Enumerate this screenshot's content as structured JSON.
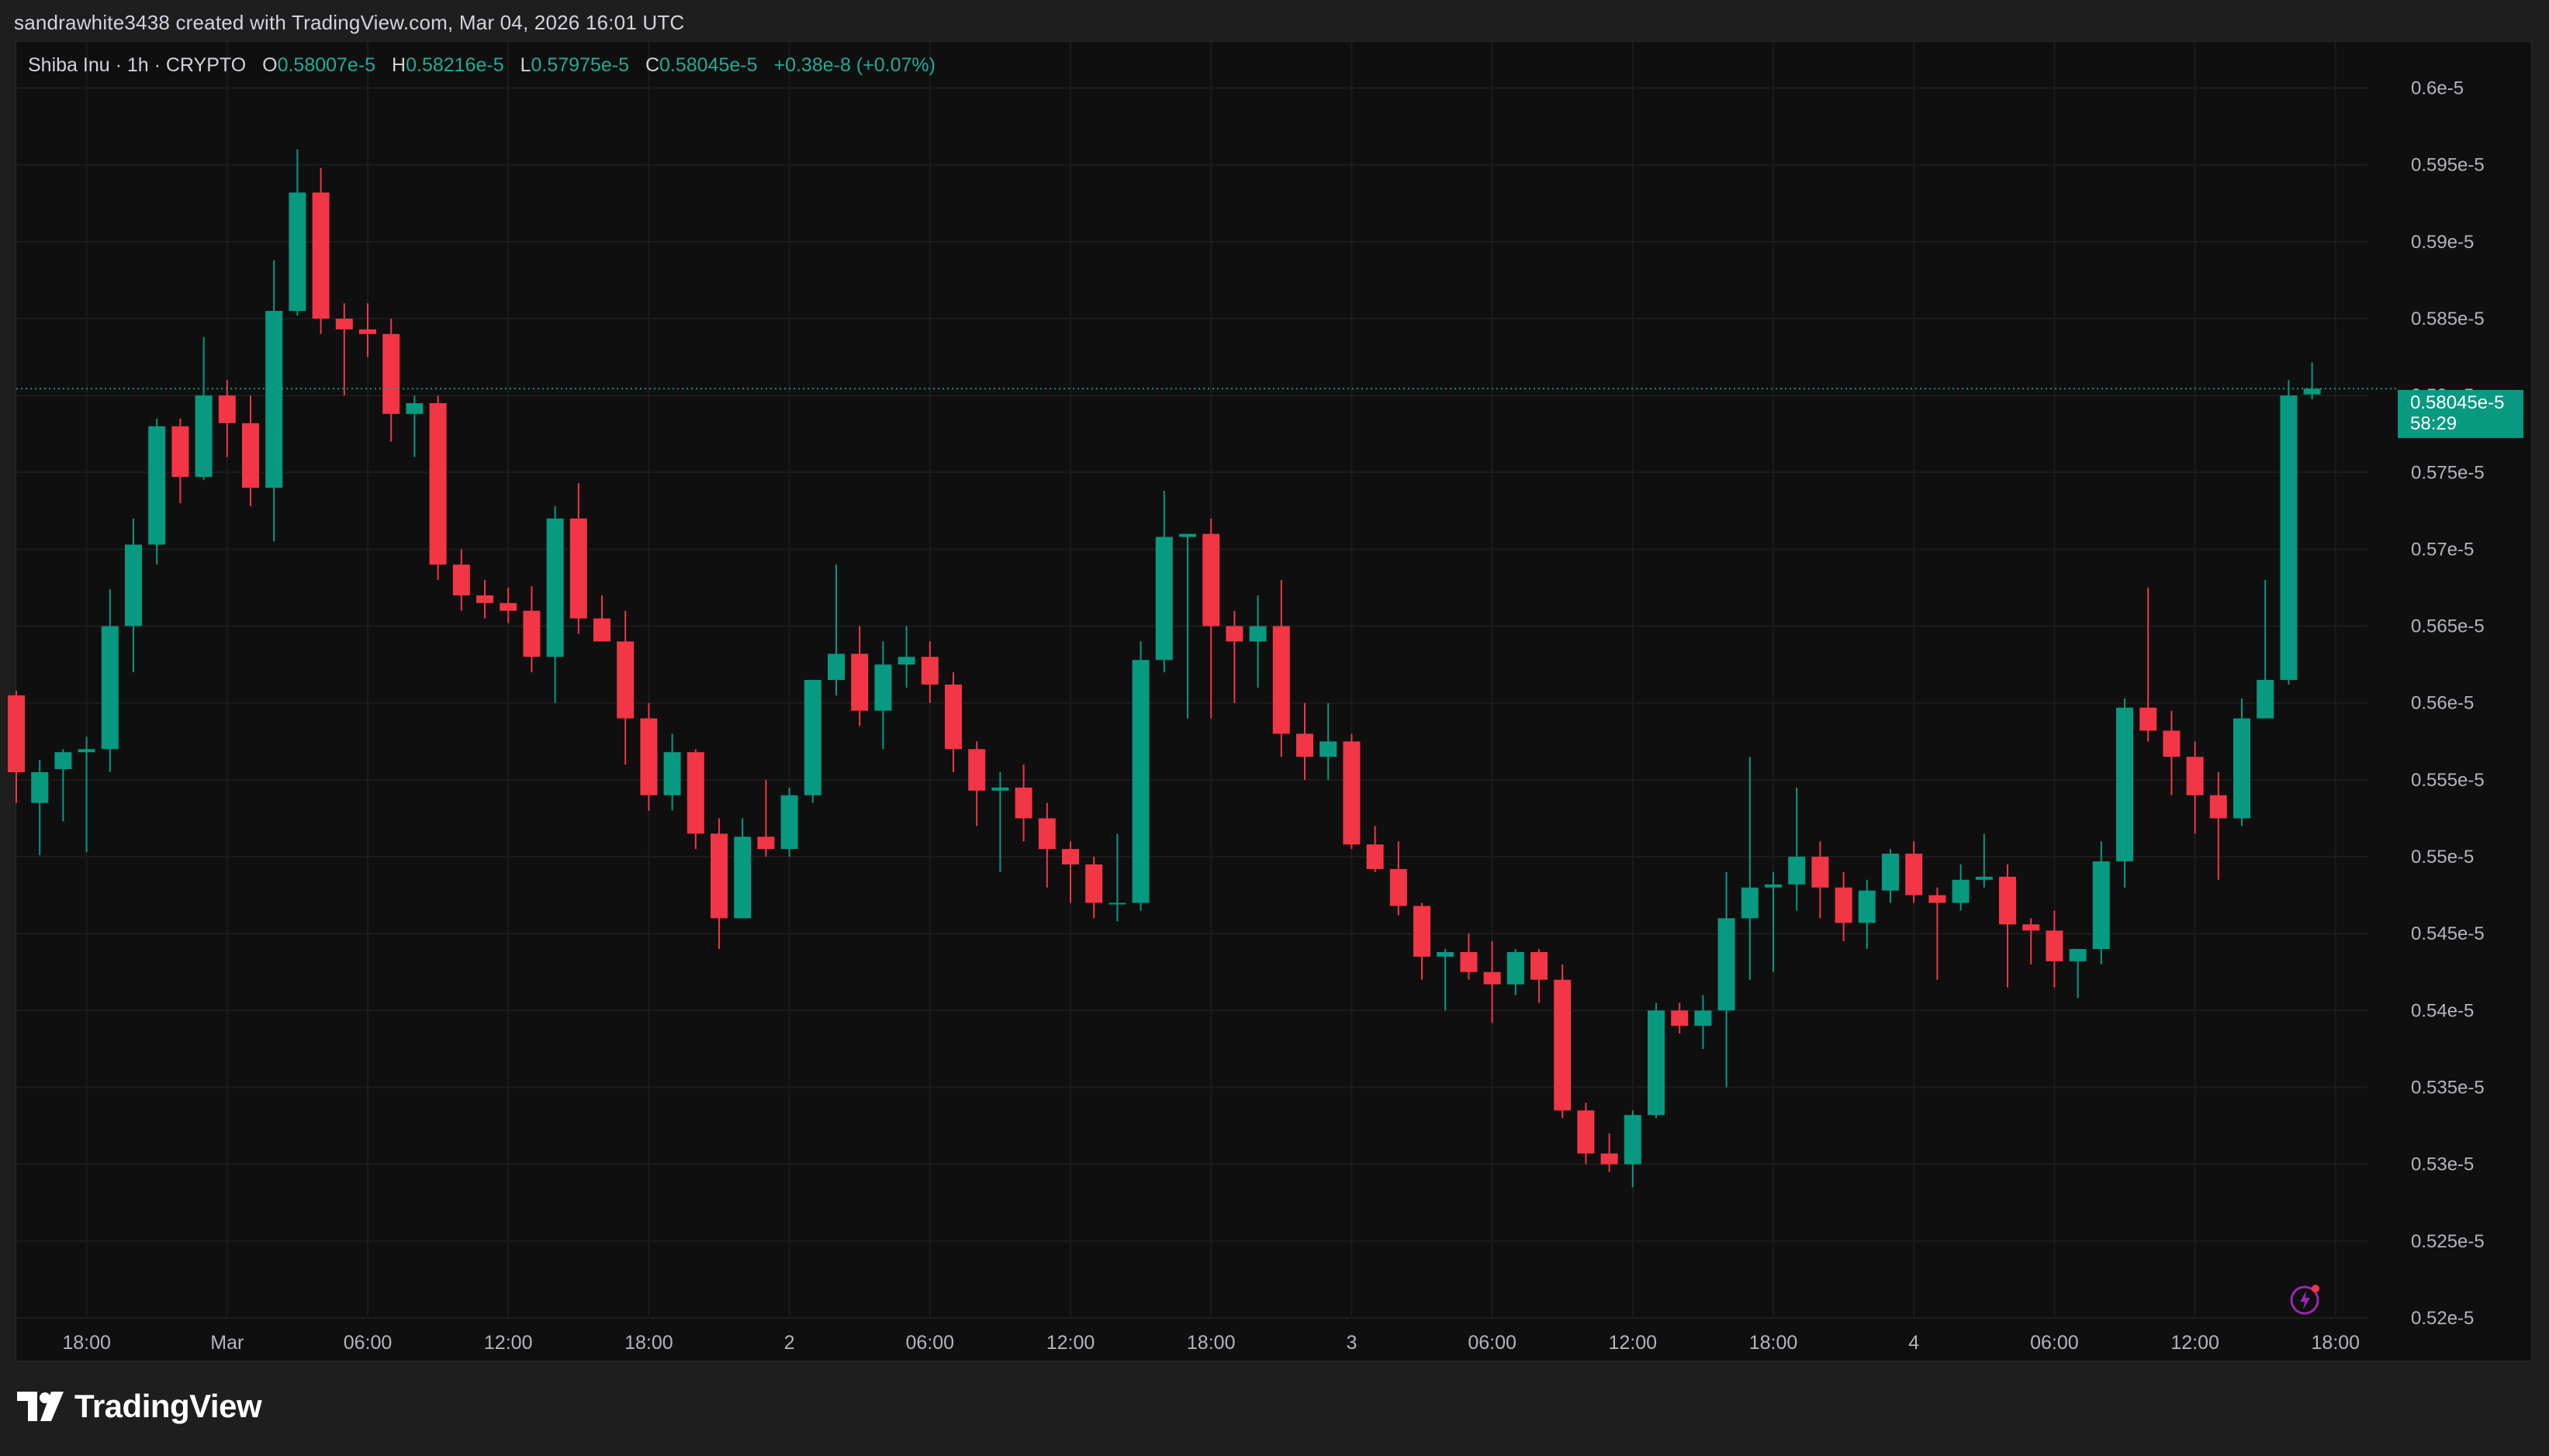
{
  "caption": "sandrawhite3438 created with TradingView.com, Mar 04, 2026 16:01 UTC",
  "legend": {
    "symbol": "Shiba Inu · 1h · CRYPTO",
    "o_label": "O",
    "o_value": "0.58007e-5",
    "h_label": "H",
    "h_value": "0.58216e-5",
    "l_label": "L",
    "l_value": "0.57975e-5",
    "c_label": "C",
    "c_value": "0.58045e-5",
    "change": "+0.38e-8 (+0.07%)"
  },
  "last_price": {
    "value": "0.58045e-5",
    "countdown": "58:29"
  },
  "brand": "TradingView",
  "icons": [
    "tradingview-logo-icon",
    "lightning-icon"
  ],
  "colors": {
    "up": "#089981",
    "down": "#f23645",
    "background": "#0f0f0f",
    "grid": "#1c1c1c",
    "text": "#d1d4dc"
  },
  "chart_data": {
    "type": "candlestick",
    "interval": "1h",
    "y_unit": "e-5",
    "ylim": [
      0.52,
      0.603
    ],
    "y_ticks": [
      0.6,
      0.595,
      0.59,
      0.585,
      0.58,
      0.575,
      0.57,
      0.565,
      0.56,
      0.555,
      0.55,
      0.545,
      0.54,
      0.535,
      0.53,
      0.525,
      0.52
    ],
    "y_tick_labels": [
      "0.6e-5",
      "0.595e-5",
      "0.59e-5",
      "0.585e-5",
      "0.58e-5",
      "0.575e-5",
      "0.57e-5",
      "0.565e-5",
      "0.56e-5",
      "0.555e-5",
      "0.55e-5",
      "0.545e-5",
      "0.54e-5",
      "0.535e-5",
      "0.53e-5",
      "0.525e-5",
      "0.52e-5"
    ],
    "x_ticks": [
      {
        "index": 3,
        "label": "18:00"
      },
      {
        "index": 9,
        "label": "Mar"
      },
      {
        "index": 15,
        "label": "06:00"
      },
      {
        "index": 21,
        "label": "12:00"
      },
      {
        "index": 27,
        "label": "18:00"
      },
      {
        "index": 33,
        "label": "2"
      },
      {
        "index": 39,
        "label": "06:00"
      },
      {
        "index": 45,
        "label": "12:00"
      },
      {
        "index": 51,
        "label": "18:00"
      },
      {
        "index": 57,
        "label": "3"
      },
      {
        "index": 63,
        "label": "06:00"
      },
      {
        "index": 69,
        "label": "12:00"
      },
      {
        "index": 75,
        "label": "18:00"
      },
      {
        "index": 81,
        "label": "4"
      },
      {
        "index": 87,
        "label": "06:00"
      },
      {
        "index": 93,
        "label": "12:00"
      },
      {
        "index": 99,
        "label": "18:00"
      }
    ],
    "x_slots": 101,
    "candles": [
      [
        0.5605,
        0.5608,
        0.5535,
        0.5555
      ],
      [
        0.5535,
        0.5563,
        0.5501,
        0.5555
      ],
      [
        0.5557,
        0.557,
        0.5523,
        0.5568
      ],
      [
        0.5568,
        0.5578,
        0.5503,
        0.557
      ],
      [
        0.557,
        0.5674,
        0.5555,
        0.565
      ],
      [
        0.565,
        0.572,
        0.562,
        0.5703
      ],
      [
        0.5703,
        0.5785,
        0.569,
        0.578
      ],
      [
        0.578,
        0.5785,
        0.573,
        0.5747
      ],
      [
        0.5747,
        0.5838,
        0.5745,
        0.58
      ],
      [
        0.58,
        0.581,
        0.576,
        0.5782
      ],
      [
        0.5782,
        0.58,
        0.5728,
        0.574
      ],
      [
        0.574,
        0.5888,
        0.5705,
        0.5855
      ],
      [
        0.5855,
        0.596,
        0.5852,
        0.5932
      ],
      [
        0.5932,
        0.5948,
        0.584,
        0.585
      ],
      [
        0.585,
        0.586,
        0.58,
        0.5843
      ],
      [
        0.5843,
        0.586,
        0.5825,
        0.584
      ],
      [
        0.584,
        0.585,
        0.577,
        0.5788
      ],
      [
        0.5788,
        0.58,
        0.576,
        0.5795
      ],
      [
        0.5795,
        0.58,
        0.568,
        0.569
      ],
      [
        0.569,
        0.57,
        0.566,
        0.567
      ],
      [
        0.567,
        0.568,
        0.5655,
        0.5665
      ],
      [
        0.5665,
        0.5675,
        0.5652,
        0.566
      ],
      [
        0.566,
        0.5676,
        0.562,
        0.563
      ],
      [
        0.563,
        0.5728,
        0.56,
        0.572
      ],
      [
        0.572,
        0.5743,
        0.5645,
        0.5655
      ],
      [
        0.5655,
        0.567,
        0.564,
        0.564
      ],
      [
        0.564,
        0.566,
        0.556,
        0.559
      ],
      [
        0.559,
        0.56,
        0.553,
        0.554
      ],
      [
        0.554,
        0.558,
        0.553,
        0.5568
      ],
      [
        0.5568,
        0.557,
        0.5505,
        0.5515
      ],
      [
        0.5515,
        0.5525,
        0.544,
        0.546
      ],
      [
        0.546,
        0.5525,
        0.546,
        0.5513
      ],
      [
        0.5513,
        0.555,
        0.55,
        0.5505
      ],
      [
        0.5505,
        0.5545,
        0.55,
        0.554
      ],
      [
        0.554,
        0.558,
        0.5535,
        0.5615
      ],
      [
        0.5615,
        0.569,
        0.5605,
        0.5632
      ],
      [
        0.5632,
        0.565,
        0.5585,
        0.5595
      ],
      [
        0.5595,
        0.564,
        0.557,
        0.5625
      ],
      [
        0.5625,
        0.565,
        0.561,
        0.563
      ],
      [
        0.563,
        0.564,
        0.56,
        0.5612
      ],
      [
        0.5612,
        0.562,
        0.5555,
        0.557
      ],
      [
        0.557,
        0.5575,
        0.552,
        0.5543
      ],
      [
        0.5543,
        0.5555,
        0.549,
        0.5545
      ],
      [
        0.5545,
        0.556,
        0.551,
        0.5525
      ],
      [
        0.5525,
        0.5535,
        0.548,
        0.5505
      ],
      [
        0.5505,
        0.551,
        0.547,
        0.5495
      ],
      [
        0.5495,
        0.55,
        0.546,
        0.547
      ],
      [
        0.547,
        0.5515,
        0.5458,
        0.547
      ],
      [
        0.547,
        0.564,
        0.5465,
        0.5628
      ],
      [
        0.5628,
        0.5738,
        0.562,
        0.5708
      ],
      [
        0.5708,
        0.571,
        0.559,
        0.571
      ],
      [
        0.571,
        0.572,
        0.559,
        0.565
      ],
      [
        0.565,
        0.566,
        0.56,
        0.564
      ],
      [
        0.564,
        0.567,
        0.561,
        0.565
      ],
      [
        0.565,
        0.568,
        0.5565,
        0.558
      ],
      [
        0.558,
        0.56,
        0.555,
        0.5565
      ],
      [
        0.5565,
        0.56,
        0.555,
        0.5575
      ],
      [
        0.5575,
        0.558,
        0.5505,
        0.5508
      ],
      [
        0.5508,
        0.552,
        0.549,
        0.5492
      ],
      [
        0.5492,
        0.551,
        0.5462,
        0.5468
      ],
      [
        0.5468,
        0.547,
        0.542,
        0.5435
      ],
      [
        0.5435,
        0.544,
        0.54,
        0.5438
      ],
      [
        0.5438,
        0.545,
        0.542,
        0.5425
      ],
      [
        0.5425,
        0.5445,
        0.5392,
        0.5417
      ],
      [
        0.5417,
        0.544,
        0.541,
        0.5438
      ],
      [
        0.5438,
        0.544,
        0.5405,
        0.542
      ],
      [
        0.542,
        0.543,
        0.533,
        0.5335
      ],
      [
        0.5335,
        0.534,
        0.53,
        0.5307
      ],
      [
        0.5307,
        0.532,
        0.5295,
        0.53
      ],
      [
        0.53,
        0.5335,
        0.5285,
        0.5332
      ],
      [
        0.5332,
        0.5405,
        0.533,
        0.54
      ],
      [
        0.54,
        0.5405,
        0.5385,
        0.539
      ],
      [
        0.539,
        0.541,
        0.5375,
        0.54
      ],
      [
        0.54,
        0.549,
        0.535,
        0.546
      ],
      [
        0.546,
        0.5565,
        0.542,
        0.548
      ],
      [
        0.548,
        0.549,
        0.5425,
        0.5482
      ],
      [
        0.5482,
        0.5545,
        0.5465,
        0.55
      ],
      [
        0.55,
        0.551,
        0.546,
        0.548
      ],
      [
        0.548,
        0.549,
        0.5445,
        0.5457
      ],
      [
        0.5457,
        0.5485,
        0.544,
        0.5478
      ],
      [
        0.5478,
        0.5505,
        0.547,
        0.5502
      ],
      [
        0.5502,
        0.551,
        0.547,
        0.5475
      ],
      [
        0.5475,
        0.548,
        0.542,
        0.547
      ],
      [
        0.547,
        0.5495,
        0.5465,
        0.5485
      ],
      [
        0.5485,
        0.5515,
        0.548,
        0.5487
      ],
      [
        0.5487,
        0.5495,
        0.5415,
        0.5456
      ],
      [
        0.5456,
        0.546,
        0.543,
        0.5452
      ],
      [
        0.5452,
        0.5465,
        0.5415,
        0.5432
      ],
      [
        0.5432,
        0.544,
        0.5408,
        0.544
      ],
      [
        0.544,
        0.551,
        0.543,
        0.5497
      ],
      [
        0.5497,
        0.5603,
        0.548,
        0.5597
      ],
      [
        0.5597,
        0.5675,
        0.5575,
        0.5582
      ],
      [
        0.5582,
        0.5595,
        0.554,
        0.5565
      ],
      [
        0.5565,
        0.5575,
        0.5515,
        0.554
      ],
      [
        0.554,
        0.5555,
        0.5485,
        0.5525
      ],
      [
        0.5525,
        0.5603,
        0.552,
        0.559
      ],
      [
        0.559,
        0.568,
        0.559,
        0.5615
      ],
      [
        0.5615,
        0.581,
        0.5612,
        0.58
      ],
      [
        0.58007,
        0.58216,
        0.57975,
        0.58045
      ]
    ]
  }
}
